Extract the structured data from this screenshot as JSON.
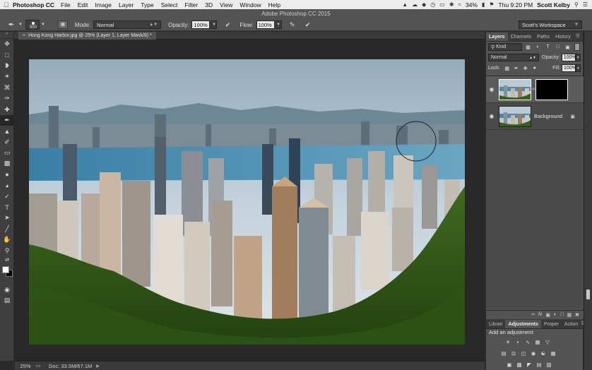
{
  "menubar": {
    "app_name": "Photoshop CC",
    "items": [
      "File",
      "Edit",
      "Image",
      "Layer",
      "Type",
      "Select",
      "Filter",
      "3D",
      "View",
      "Window",
      "Help"
    ],
    "battery": "34%",
    "clock": "Thu 9:20 PM",
    "user": "Scott Kelby"
  },
  "window": {
    "title": "Adobe Photoshop CC 2015"
  },
  "options": {
    "brush_size": "500",
    "mode_label": "Mode:",
    "mode_value": "Normal",
    "opacity_label": "Opacity:",
    "opacity_value": "100%",
    "flow_label": "Flow:",
    "flow_value": "100%",
    "workspace": "Scott's Workspace"
  },
  "document": {
    "tab_title": "Hong Kong Harbor.jpg @ 25% (Layer 1, Layer Mask/8) *"
  },
  "status": {
    "zoom": "25%",
    "doc_info": "Doc: 33.5M/67.1M"
  },
  "layers_panel": {
    "tabs": [
      "Layers",
      "Channels",
      "Paths",
      "History"
    ],
    "filter_kind": "Kind",
    "blend_mode": "Normal",
    "opacity_label": "Opacity:",
    "opacity_value": "100%",
    "lock_label": "Lock:",
    "fill_label": "Fill:",
    "fill_value": "100%",
    "layers": [
      {
        "name": "",
        "has_mask": true
      },
      {
        "name": "Background",
        "locked": true
      }
    ]
  },
  "adjustments_panel": {
    "tabs": [
      "Librari",
      "Adjustments",
      "Proper",
      "Action"
    ],
    "title": "Add an adjustment"
  },
  "colors": {
    "foreground": "#ffffff",
    "background": "#000000"
  }
}
